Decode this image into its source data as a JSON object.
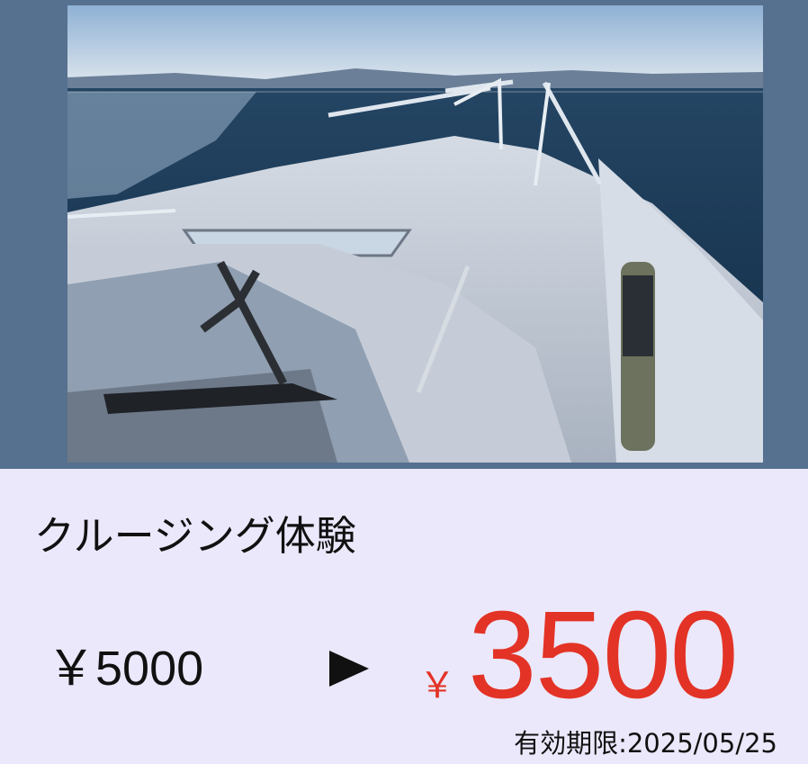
{
  "offer": {
    "title": "クルージング体験",
    "original_price": "￥5000",
    "arrow": "▶",
    "currency": "￥",
    "sale_price": "3500",
    "expiry": "有効期限:2025/05/25"
  },
  "colors": {
    "frame": "#56708f",
    "background": "#ebe8fb",
    "sale_price": "#e33326",
    "text": "#111111"
  }
}
